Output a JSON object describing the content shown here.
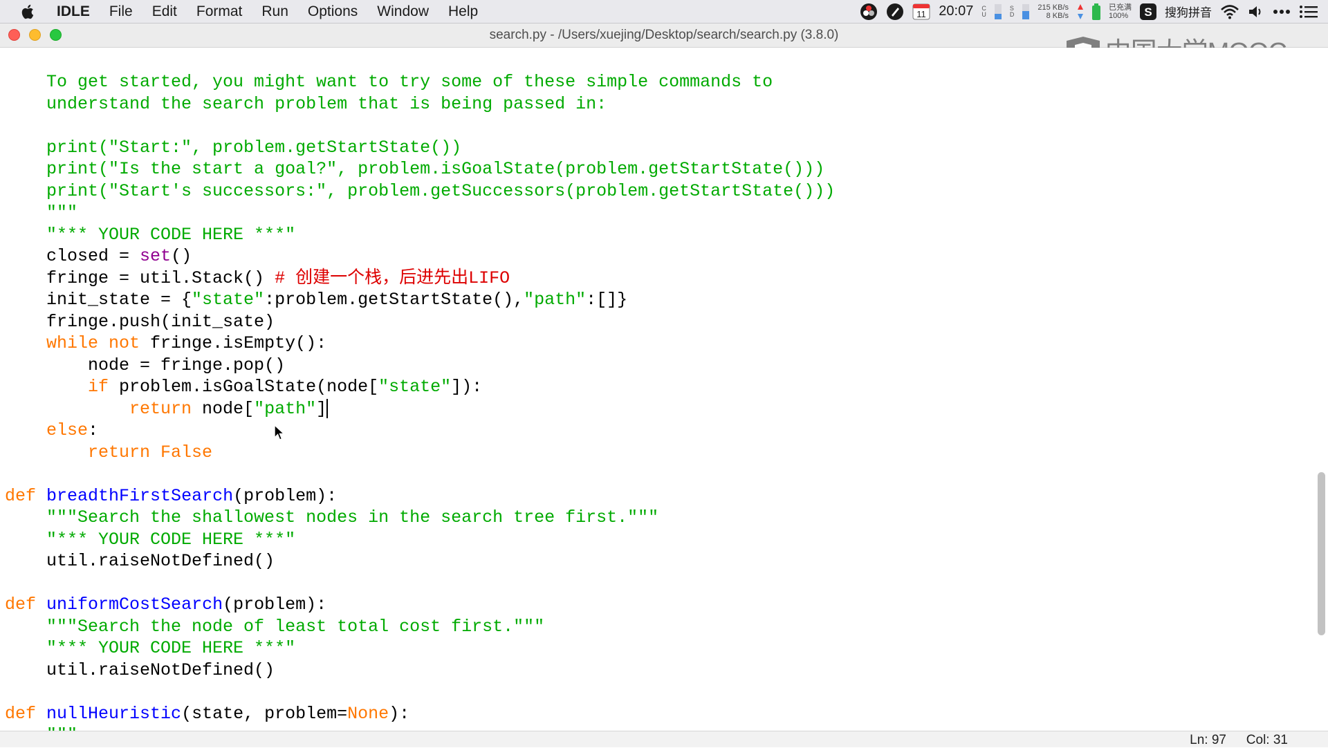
{
  "menubar": {
    "app_name": "IDLE",
    "items": [
      "File",
      "Edit",
      "Format",
      "Run",
      "Options",
      "Window",
      "Help"
    ],
    "status": {
      "calendar_day": "11",
      "clock": "20:07",
      "small_labels_1": [
        "C",
        "U"
      ],
      "small_labels_2": [
        "S",
        "D"
      ],
      "net_up": "215 KB/s",
      "net_down": "8 KB/s",
      "battery_status": "已充满",
      "battery_percent": "100%",
      "input_method": "搜狗拼音"
    }
  },
  "window": {
    "title": "search.py - /Users/xuejing/Desktop/search/search.py (3.8.0)"
  },
  "watermark": {
    "text": "中国大学MOOC"
  },
  "editor": {
    "lines": [
      [
        {
          "c": "str",
          "t": "    To get started, you might want to try some of these simple commands to"
        }
      ],
      [
        {
          "c": "str",
          "t": "    understand the search problem that is being passed in:"
        }
      ],
      [
        {
          "c": "",
          "t": ""
        }
      ],
      [
        {
          "c": "str",
          "t": "    print(\"Start:\", problem.getStartState())"
        }
      ],
      [
        {
          "c": "str",
          "t": "    print(\"Is the start a goal?\", problem.isGoalState(problem.getStartState()))"
        }
      ],
      [
        {
          "c": "str",
          "t": "    print(\"Start's successors:\", problem.getSuccessors(problem.getStartState()))"
        }
      ],
      [
        {
          "c": "str",
          "t": "    \"\"\""
        }
      ],
      [
        {
          "c": "str",
          "t": "    \"*** YOUR CODE HERE ***\""
        }
      ],
      [
        {
          "c": "",
          "t": "    closed = "
        },
        {
          "c": "bi",
          "t": "set"
        },
        {
          "c": "",
          "t": "()"
        }
      ],
      [
        {
          "c": "",
          "t": "    fringe = util.Stack() "
        },
        {
          "c": "com",
          "t": "# 创建一个栈，后进先出LIFO"
        }
      ],
      [
        {
          "c": "",
          "t": "    init_state = {"
        },
        {
          "c": "str",
          "t": "\"state\""
        },
        {
          "c": "",
          "t": ":problem.getStartState(),"
        },
        {
          "c": "str",
          "t": "\"path\""
        },
        {
          "c": "",
          "t": ":[]}"
        }
      ],
      [
        {
          "c": "",
          "t": "    fringe.push(init_sate)"
        }
      ],
      [
        {
          "c": "kw",
          "t": "    while not"
        },
        {
          "c": "",
          "t": " fringe.isEmpty():"
        }
      ],
      [
        {
          "c": "",
          "t": "        node = fringe.pop()"
        }
      ],
      [
        {
          "c": "kw",
          "t": "        if"
        },
        {
          "c": "",
          "t": " problem.isGoalState(node["
        },
        {
          "c": "str",
          "t": "\"state\""
        },
        {
          "c": "",
          "t": "]):"
        }
      ],
      [
        {
          "c": "kw",
          "t": "            return"
        },
        {
          "c": "",
          "t": " node["
        },
        {
          "c": "str",
          "t": "\"path\""
        },
        {
          "c": "",
          "t": "]"
        }
      ],
      [
        {
          "c": "kw",
          "t": "    else"
        },
        {
          "c": "",
          "t": ":"
        }
      ],
      [
        {
          "c": "kw",
          "t": "        return False"
        }
      ],
      [
        {
          "c": "",
          "t": ""
        }
      ],
      [
        {
          "c": "kw",
          "t": "def"
        },
        {
          "c": "",
          "t": " "
        },
        {
          "c": "def",
          "t": "breadthFirstSearch"
        },
        {
          "c": "",
          "t": "(problem):"
        }
      ],
      [
        {
          "c": "str",
          "t": "    \"\"\"Search the shallowest nodes in the search tree first.\"\"\""
        }
      ],
      [
        {
          "c": "str",
          "t": "    \"*** YOUR CODE HERE ***\""
        }
      ],
      [
        {
          "c": "",
          "t": "    util.raiseNotDefined()"
        }
      ],
      [
        {
          "c": "",
          "t": ""
        }
      ],
      [
        {
          "c": "kw",
          "t": "def"
        },
        {
          "c": "",
          "t": " "
        },
        {
          "c": "def",
          "t": "uniformCostSearch"
        },
        {
          "c": "",
          "t": "(problem):"
        }
      ],
      [
        {
          "c": "str",
          "t": "    \"\"\"Search the node of least total cost first.\"\"\""
        }
      ],
      [
        {
          "c": "str",
          "t": "    \"*** YOUR CODE HERE ***\""
        }
      ],
      [
        {
          "c": "",
          "t": "    util.raiseNotDefined()"
        }
      ],
      [
        {
          "c": "",
          "t": ""
        }
      ],
      [
        {
          "c": "kw",
          "t": "def"
        },
        {
          "c": "",
          "t": " "
        },
        {
          "c": "def",
          "t": "nullHeuristic"
        },
        {
          "c": "",
          "t": "(state, problem="
        },
        {
          "c": "kw",
          "t": "None"
        },
        {
          "c": "",
          "t": "):"
        }
      ],
      [
        {
          "c": "str",
          "t": "    \"\"\""
        }
      ]
    ]
  },
  "statusbar": {
    "ln": "Ln: 97",
    "col": "Col: 31"
  },
  "colors": {
    "string": "#00aa00",
    "keyword": "#ff7700",
    "comment": "#dd0000",
    "builtin": "#900090",
    "definition": "#0000ff"
  }
}
